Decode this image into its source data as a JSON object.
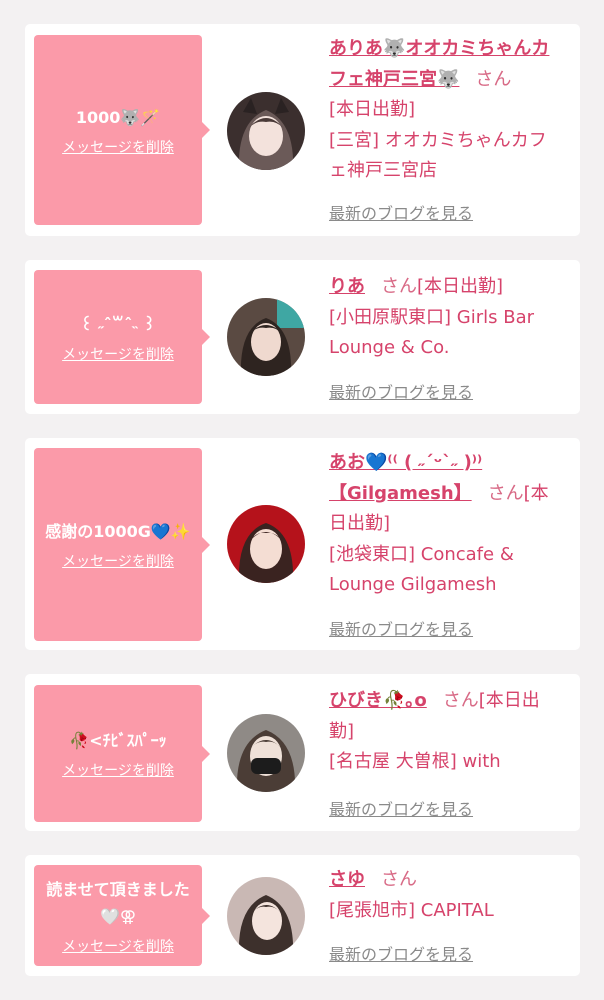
{
  "delete_label": "メッセージを削除",
  "blog_label": "最新のブログを見る",
  "honorific": "さん",
  "cards": [
    {
      "message": "1000🐺🪄",
      "name": "ありあ🐺オオカミちゃんカフェ神戸三宮🐺",
      "status": "[本日出勤]",
      "shop": "[三宮] オオカミちゃんカフェ神戸三宮店"
    },
    {
      "message": "꒰ ˶ˆ꒳ˆ˵ ꒱",
      "name": "りあ",
      "status": "[本日出勤]",
      "shop": "[小田原駅東口] Girls Bar Lounge & Co."
    },
    {
      "message": "感謝の1000G💙✨",
      "name": "あお💙⁽⁽ ( ˶ˊᵕˋ˶ )⁾⁾【Gilgamesh】",
      "status": "[本日出勤]",
      "shop": "[池袋東口] Concafe & Lounge Gilgamesh"
    },
    {
      "message": "🥀<ﾁﾋﾞｽﾊﾟｰｯ",
      "name": "ひびき🥀｡o",
      "status": "[本日出勤]",
      "shop": "[名古屋 大曽根] with"
    },
    {
      "message": "読ませて頂きました🤍⚢",
      "name": "さゆ",
      "status": "",
      "shop": "[尾張旭市] CAPITAL"
    }
  ],
  "colors": {
    "background": "#f3f1f2",
    "bubble": "#fb9aa9",
    "name_pink": "#d6436b",
    "link_gray": "#8a8a8a"
  }
}
